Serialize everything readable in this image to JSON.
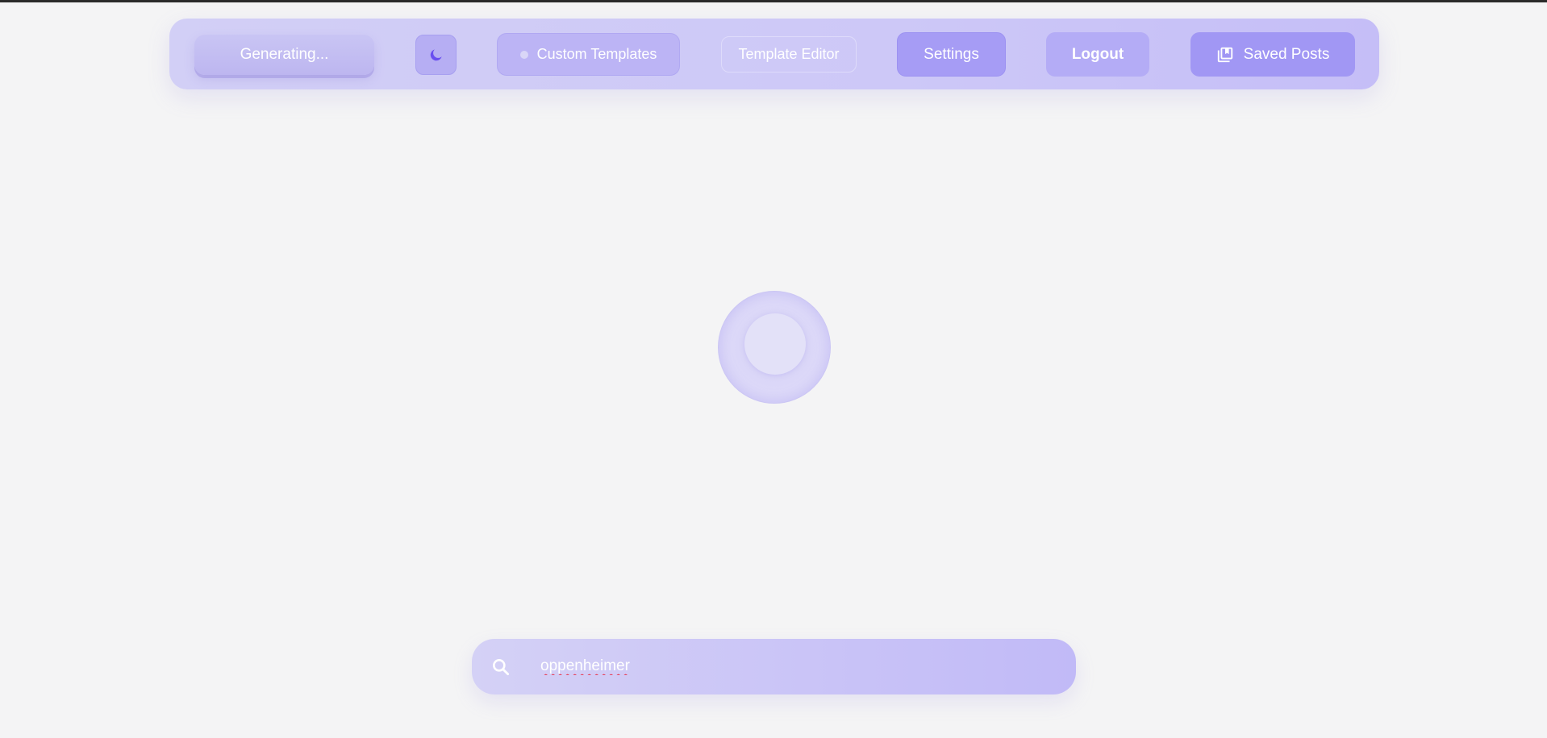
{
  "navbar": {
    "generating_label": "Generating...",
    "theme_toggle_icon": "moon-icon",
    "custom_templates_label": "Custom Templates",
    "template_editor_label": "Template Editor",
    "settings_label": "Settings",
    "logout_label": "Logout",
    "saved_posts_label": "Saved Posts",
    "saved_posts_icon": "library-icon"
  },
  "loader": {
    "icon": "spinner"
  },
  "search": {
    "value": "oppenheimer",
    "icon": "search-icon"
  },
  "colors": {
    "background": "#f4f4f5",
    "accent": "#a197f4",
    "moon": "#6a4ff0",
    "spellcheck_underline": "#e5455f"
  }
}
